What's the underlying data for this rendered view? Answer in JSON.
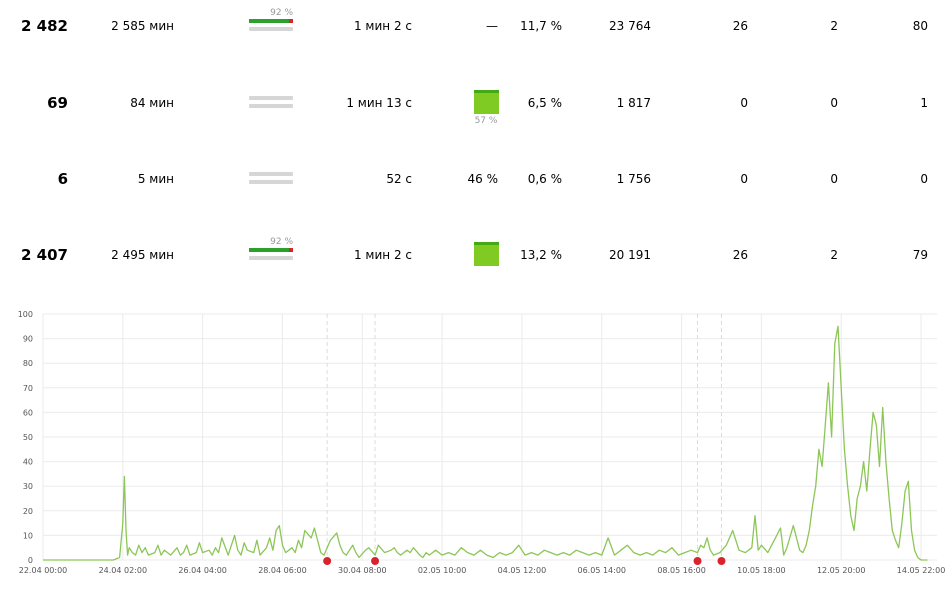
{
  "table": {
    "rows": [
      {
        "visits": "2 482",
        "time": "2 585 мин",
        "bar_pct": "92 %",
        "bar_fill": 0.92,
        "bar_empty": false,
        "duration": "1 мин 2 с",
        "mid": "—",
        "mid_square": false,
        "mid_sq_label": "",
        "share": "11,7 %",
        "views": "23 764",
        "c1": "26",
        "c2": "2",
        "c3": "80"
      },
      {
        "visits": "69",
        "time": "84 мин",
        "bar_pct": "",
        "bar_fill": 0,
        "bar_empty": true,
        "duration": "1 мин 13 с",
        "mid": "",
        "mid_square": true,
        "mid_sq_label": "57 %",
        "share": "6,5 %",
        "views": "1 817",
        "c1": "0",
        "c2": "0",
        "c3": "1"
      },
      {
        "visits": "6",
        "time": "5 мин",
        "bar_pct": "",
        "bar_fill": 0,
        "bar_empty": true,
        "duration": "52 с",
        "mid": "46 %",
        "mid_square": false,
        "mid_sq_label": "",
        "share": "0,6 %",
        "views": "1 756",
        "c1": "0",
        "c2": "0",
        "c3": "0"
      },
      {
        "visits": "2 407",
        "time": "2 495 мин",
        "bar_pct": "92 %",
        "bar_fill": 0.92,
        "bar_empty": false,
        "duration": "1 мин 2 с",
        "mid": "",
        "mid_square": true,
        "mid_sq_label": "",
        "share": "13,2 %",
        "views": "20 191",
        "c1": "26",
        "c2": "2",
        "c3": "79"
      }
    ]
  },
  "colors": {
    "line": "#8cc657",
    "grid": "#ebebeb",
    "marker": "#d9232d",
    "bar_green": "#2ca02c",
    "square": "#7fcb23"
  },
  "chart_data": {
    "type": "line",
    "title": "",
    "xlabel": "",
    "ylabel": "",
    "ylim": [
      0,
      100
    ],
    "yticks": [
      "0",
      "10",
      "20",
      "30",
      "40",
      "50",
      "60",
      "70",
      "80",
      "90",
      "100"
    ],
    "xticks": [
      "22.04 00:00",
      "24.04 02:00",
      "26.04 04:00",
      "28.04 06:00",
      "30.04 08:00",
      "02.05 10:00",
      "04.05 12:00",
      "06.05 14:00",
      "08.05 16:00",
      "10.05 18:00",
      "12.05 20:00",
      "14.05 22:00"
    ],
    "xlim_hours": [
      0,
      560
    ],
    "grid": true,
    "series": [
      {
        "values_hours": [
          0,
          44,
          48,
          50,
          51,
          52,
          53,
          54,
          56,
          58,
          60,
          62,
          64,
          66,
          70,
          72,
          74,
          76,
          78,
          80,
          84,
          86,
          88,
          90,
          92,
          96,
          98,
          100,
          104,
          106,
          108,
          110,
          112,
          116,
          118,
          120,
          122,
          124,
          126,
          128,
          132,
          134,
          136,
          140,
          142,
          144,
          146,
          148,
          150,
          152,
          156,
          158,
          160,
          162,
          164,
          168,
          170,
          172,
          174,
          176,
          180,
          184,
          186,
          188,
          190,
          194,
          196,
          198,
          202,
          204,
          208,
          210,
          214,
          218,
          220,
          222,
          224,
          228,
          230,
          232,
          236,
          238,
          240,
          242,
          246,
          250,
          254,
          258,
          262,
          266,
          270,
          274,
          278,
          282,
          286,
          290,
          294,
          298,
          302,
          306,
          310,
          314,
          318,
          322,
          326,
          330,
          334,
          338,
          342,
          346,
          350,
          354,
          358,
          362,
          366,
          370,
          374,
          378,
          382,
          386,
          390,
          394,
          398,
          402,
          406,
          410,
          412,
          414,
          416,
          418,
          420,
          424,
          428,
          432,
          436,
          440,
          444,
          446,
          448,
          450,
          454,
          458,
          462,
          464,
          466,
          470,
          474,
          476,
          478,
          480,
          482,
          484,
          486,
          488,
          490,
          492,
          494,
          496,
          498,
          500,
          502,
          504,
          506,
          508,
          510,
          512,
          514,
          516,
          518,
          520,
          522,
          524,
          526,
          528,
          530,
          532,
          534,
          536,
          538,
          540,
          542,
          544,
          546,
          548,
          550,
          552,
          554,
          556,
          560
        ],
        "values": [
          0,
          0,
          1,
          15,
          34,
          12,
          2,
          5,
          3,
          2,
          6,
          3,
          5,
          2,
          3,
          6,
          2,
          4,
          3,
          2,
          5,
          2,
          3,
          6,
          2,
          3,
          7,
          3,
          4,
          2,
          5,
          3,
          9,
          2,
          6,
          10,
          4,
          2,
          7,
          4,
          3,
          8,
          2,
          5,
          9,
          4,
          12,
          14,
          6,
          3,
          5,
          3,
          8,
          5,
          12,
          9,
          13,
          8,
          3,
          2,
          8,
          11,
          6,
          3,
          2,
          6,
          3,
          1,
          4,
          5,
          2,
          6,
          3,
          4,
          5,
          3,
          2,
          4,
          3,
          5,
          2,
          1,
          3,
          2,
          4,
          2,
          3,
          2,
          5,
          3,
          2,
          4,
          2,
          1,
          3,
          2,
          3,
          6,
          2,
          3,
          2,
          4,
          3,
          2,
          3,
          2,
          4,
          3,
          2,
          3,
          2,
          9,
          2,
          4,
          6,
          3,
          2,
          3,
          2,
          4,
          3,
          5,
          2,
          3,
          4,
          3,
          6,
          5,
          9,
          4,
          2,
          3,
          6,
          12,
          4,
          3,
          5,
          18,
          4,
          6,
          3,
          8,
          13,
          2,
          5,
          14,
          4,
          3,
          6,
          12,
          22,
          30,
          45,
          38,
          55,
          72,
          50,
          88,
          95,
          70,
          45,
          30,
          18,
          12,
          25,
          30,
          40,
          28,
          45,
          60,
          55,
          38,
          62,
          40,
          25,
          12,
          8,
          5,
          15,
          28,
          32,
          12,
          4,
          1,
          0,
          0,
          0
        ]
      }
    ],
    "events_hours": [
      178,
      208,
      410,
      425
    ]
  }
}
